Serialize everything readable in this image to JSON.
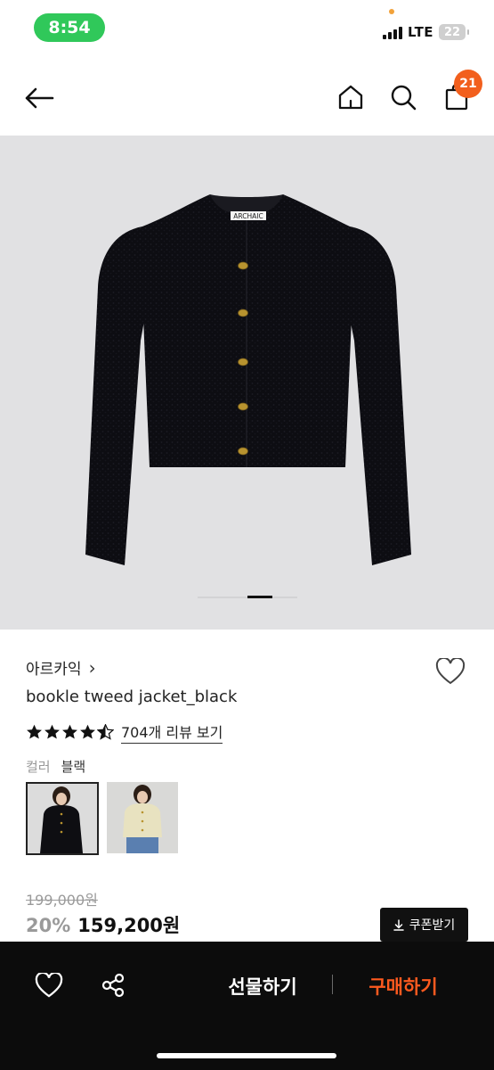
{
  "status_bar": {
    "time": "8:54",
    "network": "LTE",
    "battery": "22"
  },
  "header": {
    "cart_count": "21",
    "icons": [
      "back-arrow-icon",
      "home-icon",
      "search-icon",
      "shopping-bag-icon"
    ]
  },
  "gallery": {
    "brand_tag": "ARCHAIC",
    "slide_count": 4,
    "active_slide": 3
  },
  "product": {
    "brand": "아르카익",
    "brand_chevron": "›",
    "name": "bookle tweed jacket_black",
    "rating": 4.5,
    "review_label": "704개 리뷰 보기",
    "option_label": "컬러",
    "option_value": "블랙",
    "original_price": "199,000원",
    "discount": "20%",
    "sale_price": "159,200원",
    "coupon_label": "쿠폰받기"
  },
  "bottom_bar": {
    "gift_label": "선물하기",
    "buy_label": "구매하기"
  },
  "colors": {
    "accent_orange": "#ff5a1f",
    "badge_orange": "#f25f1d",
    "status_green": "#30c85a",
    "bar_black": "#0c0c0c"
  }
}
